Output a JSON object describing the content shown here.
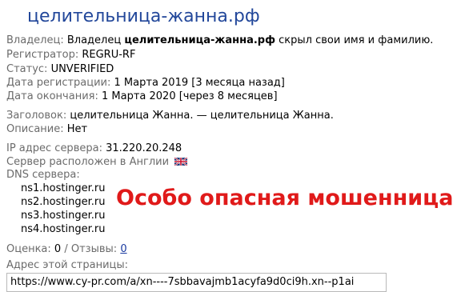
{
  "title": "целительница-жанна.рф",
  "owner": {
    "label": "Владелец:",
    "prefix": "Владелец",
    "domain": "целительница-жанна.рф",
    "suffix": "скрыл свои имя и фамилию."
  },
  "registrar": {
    "label": "Регистратор:",
    "value": "REGRU-RF"
  },
  "status": {
    "label": "Статус:",
    "value": "UNVERIFIED"
  },
  "reg_date": {
    "label": "Дата регистрации:",
    "value": "1 Марта 2019 [3 месяца назад]"
  },
  "exp_date": {
    "label": "Дата окончания:",
    "value": "1 Марта 2020 [через 8 месяцев]"
  },
  "heading": {
    "label": "Заголовок:",
    "value": "целительница Жанна. — целительница Жанна."
  },
  "description": {
    "label": "Описание:",
    "value": "Нет"
  },
  "ip": {
    "label": "IP адрес сервера:",
    "value": "31.220.20.248"
  },
  "server_location": {
    "label": "Сервер расположен в",
    "value": "Англии"
  },
  "dns": {
    "label": "DNS сервера:",
    "servers": [
      "ns1.hostinger.ru",
      "ns2.hostinger.ru",
      "ns3.hostinger.ru",
      "ns4.hostinger.ru"
    ]
  },
  "warning_text": "Особо опасная мошенница",
  "rating": {
    "label": "Оценка:",
    "value": "0",
    "separator": "/",
    "reviews_label": "Отзывы:",
    "reviews_value": "0"
  },
  "page_address": {
    "label": "Адрес этой страницы:",
    "value": "https://www.cy-pr.com/a/xn----7sbbavajmb1acyfa9d0ci9h.xn--p1ai"
  },
  "colors": {
    "title": "#22479a",
    "label": "#6b6b6b",
    "warning": "#e01a1a",
    "link": "#1a3aa0"
  },
  "icons": {
    "flag": "uk-flag-icon"
  }
}
